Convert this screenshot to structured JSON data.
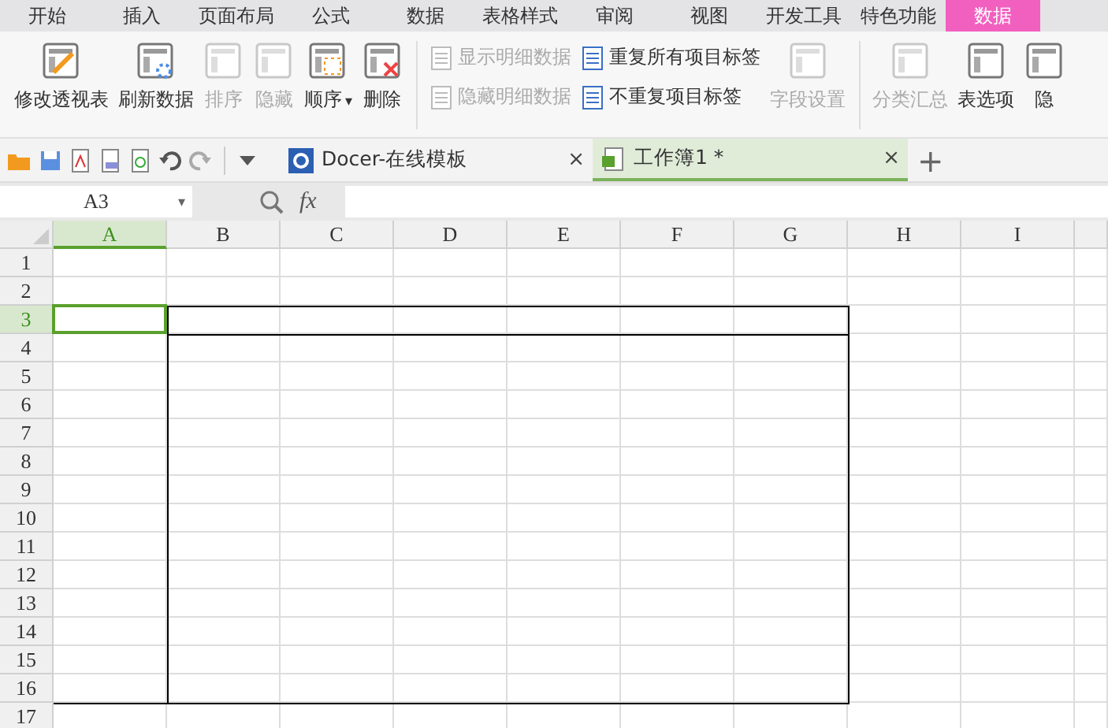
{
  "menu_tabs": [
    {
      "label": "开始",
      "selected": false
    },
    {
      "label": "插入",
      "selected": false
    },
    {
      "label": "页面布局",
      "selected": false
    },
    {
      "label": "公式",
      "selected": false
    },
    {
      "label": "数据",
      "selected": false
    },
    {
      "label": "表格样式",
      "selected": false
    },
    {
      "label": "审阅",
      "selected": false
    },
    {
      "label": "视图",
      "selected": false
    },
    {
      "label": "开发工具",
      "selected": false
    },
    {
      "label": "特色功能",
      "selected": false
    },
    {
      "label": "数据",
      "selected": true
    }
  ],
  "ribbon": [
    {
      "kind": "large",
      "label": "修改透视表",
      "disabled": false
    },
    {
      "kind": "large",
      "label": "刷新数据",
      "disabled": false
    },
    {
      "kind": "large",
      "label": "排序",
      "disabled": true
    },
    {
      "kind": "large",
      "label": "隐藏",
      "disabled": true
    },
    {
      "kind": "dropdown",
      "label": "顺序",
      "caret": "▾",
      "disabled": false
    },
    {
      "kind": "large",
      "label": "删除",
      "disabled": false
    },
    {
      "kind": "separator"
    },
    {
      "kind": "small_pair",
      "items": [
        {
          "label": "显示明细数据",
          "disabled": true
        },
        {
          "label": "隐藏明细数据",
          "disabled": true
        }
      ]
    },
    {
      "kind": "small_pair",
      "items": [
        {
          "label": "重复所有项目标签",
          "disabled": false
        },
        {
          "label": "不重复项目标签",
          "disabled": false
        }
      ]
    },
    {
      "kind": "large",
      "label": "字段设置",
      "disabled": true
    },
    {
      "kind": "separator"
    },
    {
      "kind": "large",
      "label": "分类汇总",
      "disabled": true
    },
    {
      "kind": "large",
      "label": "表选项",
      "disabled": false
    },
    {
      "kind": "large",
      "label": "隐",
      "disabled": false
    }
  ],
  "doc_tabs": [
    {
      "label": "Docer-在线模板",
      "selected": false,
      "close": "×"
    },
    {
      "label": "工作簿1 *",
      "selected": true,
      "close": "×"
    }
  ],
  "new_tab": "+",
  "formula_bar": {
    "name_box": "A3",
    "caret": "▾",
    "fx": "fx"
  },
  "columns": [
    {
      "label": "A",
      "selected": true
    },
    {
      "label": "B",
      "selected": false
    },
    {
      "label": "C",
      "selected": false
    },
    {
      "label": "D",
      "selected": false
    },
    {
      "label": "E",
      "selected": false
    },
    {
      "label": "F",
      "selected": false
    },
    {
      "label": "G",
      "selected": false
    },
    {
      "label": "H",
      "selected": false
    },
    {
      "label": "I",
      "selected": false
    }
  ],
  "rows": [
    {
      "label": "1",
      "selected": false
    },
    {
      "label": "2",
      "selected": false
    },
    {
      "label": "3",
      "selected": true
    },
    {
      "label": "4",
      "selected": false
    },
    {
      "label": "5",
      "selected": false
    },
    {
      "label": "6",
      "selected": false
    },
    {
      "label": "7",
      "selected": false
    },
    {
      "label": "8",
      "selected": false
    },
    {
      "label": "9",
      "selected": false
    },
    {
      "label": "10",
      "selected": false
    },
    {
      "label": "11",
      "selected": false
    },
    {
      "label": "12",
      "selected": false
    },
    {
      "label": "13",
      "selected": false
    },
    {
      "label": "14",
      "selected": false
    },
    {
      "label": "15",
      "selected": false
    },
    {
      "label": "16",
      "selected": false
    },
    {
      "label": "17",
      "selected": false
    }
  ]
}
